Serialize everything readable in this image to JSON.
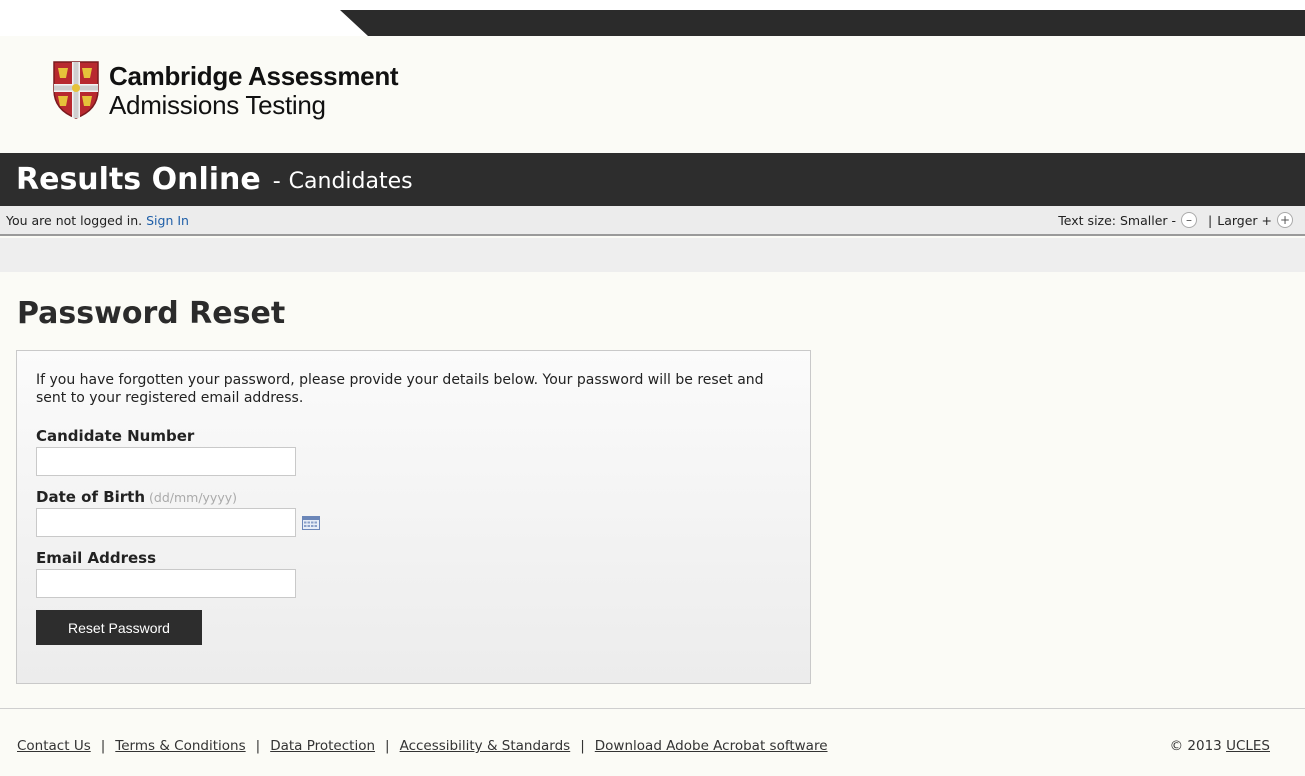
{
  "brand": {
    "line1": "Cambridge Assessment",
    "line2": "Admissions Testing"
  },
  "header": {
    "title": "Results Online",
    "separator": "-",
    "subtitle": "Candidates"
  },
  "status": {
    "message": "You are not logged in.",
    "sign_in": "Sign In",
    "text_size_label": "Text size: Smaller -",
    "smaller_icon": "minus-circle-icon",
    "divider": "|",
    "larger_label": "Larger +",
    "larger_icon": "plus-circle-icon"
  },
  "page": {
    "title": "Password Reset"
  },
  "form": {
    "intro": "If you have forgotten your password, please provide your details below. Your password will be reset and sent to your registered email address.",
    "candidate_label": "Candidate Number",
    "candidate_value": "",
    "dob_label": "Date of Birth",
    "dob_hint": "(dd/mm/yyyy)",
    "dob_value": "",
    "calendar_icon": "calendar-icon",
    "email_label": "Email Address",
    "email_value": "",
    "submit": "Reset Password"
  },
  "footer": {
    "links": [
      "Contact Us",
      "Terms & Conditions",
      "Data Protection",
      "Accessibility & Standards",
      "Download Adobe Acrobat software"
    ],
    "separator": "|",
    "copyright_prefix": "© 2013",
    "copyright_link": "UCLES"
  },
  "colors": {
    "header_bg": "#2d2d2d",
    "link": "#1f5fa8",
    "page_bg": "#fbfbf6"
  }
}
